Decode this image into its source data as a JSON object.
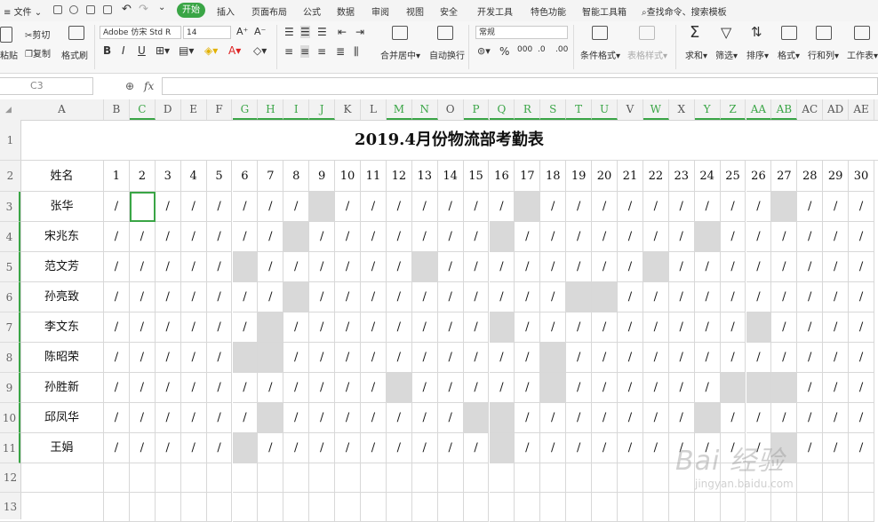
{
  "menubar": {
    "file": "文件",
    "tabs": [
      "插入",
      "页面布局",
      "公式",
      "数据",
      "审阅",
      "视图",
      "安全",
      "开发工具",
      "特色功能",
      "智能工具箱"
    ],
    "active_tab": "开始",
    "search": "查找命令、搜索模板"
  },
  "ribbon": {
    "cut": "剪切",
    "paste": "粘贴",
    "copy": "复制",
    "format_painter": "格式刷",
    "font_name": "Adobe 仿宋 Std R",
    "font_size": "14",
    "merge_center": "合并居中",
    "wrap_text": "自动换行",
    "number_format": "常规",
    "conditional_format": "条件格式",
    "table_style": "表格样式",
    "sum": "求和",
    "filter": "筛选",
    "sort": "排序",
    "format": "格式",
    "rows_cols": "行和列",
    "worksheet": "工作表"
  },
  "formula_bar": {
    "name_box": "C3",
    "fx": "fx",
    "value": ""
  },
  "columns": [
    "A",
    "B",
    "C",
    "D",
    "E",
    "F",
    "G",
    "H",
    "I",
    "J",
    "K",
    "L",
    "M",
    "N",
    "O",
    "P",
    "Q",
    "R",
    "S",
    "T",
    "U",
    "V",
    "W",
    "X",
    "Y",
    "Z",
    "AA",
    "AB",
    "AC",
    "AD",
    "AE"
  ],
  "highlighted_columns": [
    "C",
    "G",
    "H",
    "I",
    "J",
    "M",
    "N",
    "P",
    "Q",
    "R",
    "S",
    "T",
    "U",
    "W",
    "Y",
    "Z",
    "AA",
    "AB"
  ],
  "rows": [
    "1",
    "2",
    "3",
    "4",
    "5",
    "6",
    "7",
    "8",
    "9",
    "10",
    "11",
    "12",
    "13"
  ],
  "sheet": {
    "title": "2019.4月份物流部考勤表",
    "name_header": "姓名",
    "days": [
      "1",
      "2",
      "3",
      "4",
      "5",
      "6",
      "7",
      "8",
      "9",
      "10",
      "11",
      "12",
      "13",
      "14",
      "15",
      "16",
      "17",
      "18",
      "19",
      "20",
      "21",
      "22",
      "23",
      "24",
      "25",
      "26",
      "27",
      "28",
      "29",
      "30"
    ],
    "employees": [
      {
        "name": "张华",
        "marks": [
          "/",
          "",
          "/",
          "/",
          "/",
          "/",
          "/",
          "/",
          "",
          "/",
          "/",
          "/",
          "/",
          "/",
          "/",
          "/",
          "",
          "/",
          "/",
          "/",
          "/",
          "/",
          "/",
          "/",
          "/",
          "/",
          "",
          "/",
          "/",
          "/"
        ],
        "gray": [
          9,
          17,
          27
        ]
      },
      {
        "name": "宋兆东",
        "marks": [
          "/",
          "/",
          "/",
          "/",
          "/",
          "/",
          "/",
          "",
          "/",
          "/",
          "/",
          "/",
          "/",
          "/",
          "/",
          "",
          "/",
          "/",
          "/",
          "/",
          "/",
          "/",
          "/",
          "",
          "/",
          "/",
          "/",
          "/",
          "/",
          "/"
        ],
        "gray": [
          8,
          16,
          24
        ]
      },
      {
        "name": "范文芳",
        "marks": [
          "/",
          "/",
          "/",
          "/",
          "/",
          "",
          "/",
          "/",
          "/",
          "/",
          "/",
          "/",
          "",
          "/",
          "/",
          "/",
          "/",
          "/",
          "/",
          "/",
          "/",
          "",
          "/",
          "/",
          "/",
          "/",
          "/",
          "/",
          "/",
          "/"
        ],
        "gray": [
          6,
          13,
          22
        ]
      },
      {
        "name": "孙亮致",
        "marks": [
          "/",
          "/",
          "/",
          "/",
          "/",
          "/",
          "/",
          "",
          "/",
          "/",
          "/",
          "/",
          "/",
          "/",
          "/",
          "/",
          "/",
          "/",
          "",
          "",
          "/",
          "/",
          "/",
          "/",
          "/",
          "/",
          "/",
          "/",
          "/",
          "/"
        ],
        "gray": [
          8,
          19,
          20
        ]
      },
      {
        "name": "李文东",
        "marks": [
          "/",
          "/",
          "/",
          "/",
          "/",
          "/",
          "",
          "/",
          "/",
          "/",
          "/",
          "/",
          "/",
          "/",
          "/",
          "",
          "/",
          "/",
          "/",
          "/",
          "/",
          "/",
          "/",
          "/",
          "/",
          "",
          "/",
          "/",
          "/",
          "/"
        ],
        "gray": [
          7,
          16,
          26
        ]
      },
      {
        "name": "陈昭荣",
        "marks": [
          "/",
          "/",
          "/",
          "/",
          "/",
          "",
          "",
          "/",
          "/",
          "/",
          "/",
          "/",
          "/",
          "/",
          "/",
          "/",
          "/",
          "",
          "/",
          "/",
          "/",
          "/",
          "/",
          "/",
          "/",
          "/",
          "/",
          "/",
          "/",
          "/"
        ],
        "gray": [
          6,
          7,
          18
        ]
      },
      {
        "name": "孙胜新",
        "marks": [
          "/",
          "/",
          "/",
          "/",
          "/",
          "/",
          "/",
          "/",
          "/",
          "/",
          "/",
          "",
          "/",
          "/",
          "/",
          "/",
          "/",
          "",
          "/",
          "/",
          "/",
          "/",
          "/",
          "/",
          "",
          "",
          "",
          "/",
          "/",
          "/"
        ],
        "gray": [
          12,
          18,
          25,
          26,
          27
        ]
      },
      {
        "name": "邱凤华",
        "marks": [
          "/",
          "/",
          "/",
          "/",
          "/",
          "/",
          "",
          "/",
          "/",
          "/",
          "/",
          "/",
          "/",
          "/",
          "",
          "",
          "/",
          "/",
          "/",
          "/",
          "/",
          "/",
          "/",
          "",
          "/",
          "/",
          "/",
          "/",
          "/",
          "/"
        ],
        "gray": [
          7,
          15,
          16,
          24
        ]
      },
      {
        "name": "王娟",
        "marks": [
          "/",
          "/",
          "/",
          "/",
          "/",
          "",
          "/",
          "/",
          "/",
          "/",
          "/",
          "/",
          "/",
          "/",
          "/",
          "",
          "/",
          "/",
          "/",
          "/",
          "/",
          "/",
          "/",
          "/",
          "/",
          "/",
          "",
          "/",
          "/",
          "/"
        ],
        "gray": [
          6,
          16,
          27
        ]
      }
    ]
  },
  "watermark": {
    "text": "Bai 经验",
    "url": "jingyan.baidu.com"
  },
  "colors": {
    "accent": "#3aa546",
    "gray_cell": "#d9d9d9"
  }
}
